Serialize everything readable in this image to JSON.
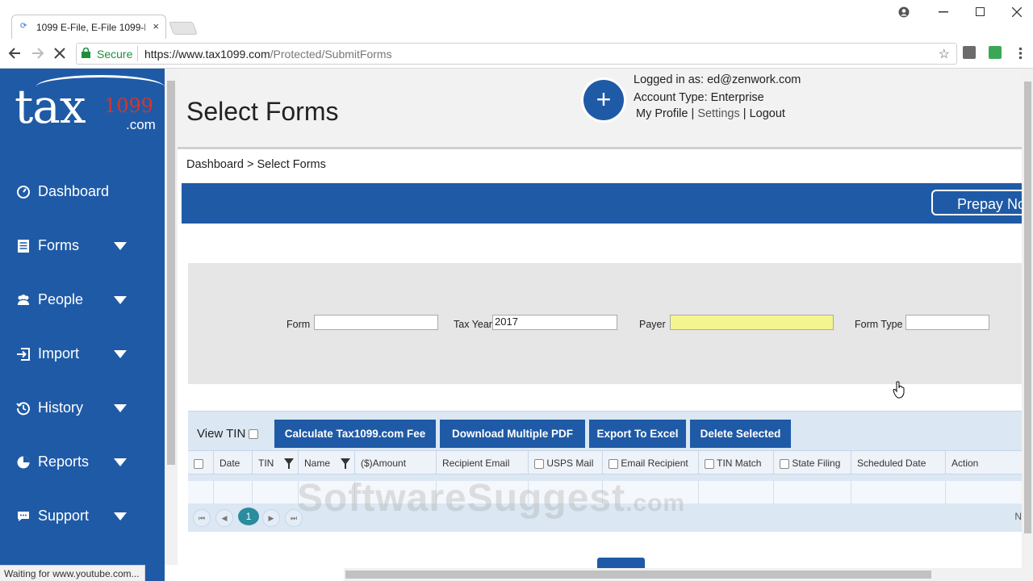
{
  "browser": {
    "tab_title": "1099 E-File, E-File 1099-M",
    "tab_close": "×",
    "secure_label": "Secure",
    "url_base": "https://www.tax1099.com",
    "url_path": "/Protected/SubmitForms"
  },
  "logo": {
    "text": "tax",
    "number": "1099",
    "suffix": ".com"
  },
  "sidebar": {
    "items": [
      {
        "label": "Dashboard",
        "icon": "dashboard-icon"
      },
      {
        "label": "Forms",
        "icon": "list-icon"
      },
      {
        "label": "People",
        "icon": "people-icon"
      },
      {
        "label": "Import",
        "icon": "import-icon"
      },
      {
        "label": "History",
        "icon": "history-icon"
      },
      {
        "label": "Reports",
        "icon": "pie-chart-icon"
      },
      {
        "label": "Support",
        "icon": "chat-icon"
      }
    ]
  },
  "header": {
    "title": "Select Forms",
    "plus": "+",
    "logged_in": "Logged in as: ed@zenwork.com",
    "account_type": "Account Type: Enterprise",
    "my_profile": "My Profile",
    "settings": "Settings",
    "logout": "Logout",
    "sep": "|"
  },
  "breadcrumb": "Dashboard > Select Forms",
  "prepay_label": "Prepay No",
  "filters": {
    "form_label": "Form",
    "form_value": "",
    "tax_year_label": "Tax Year",
    "tax_year_value": "2017",
    "payer_label": "Payer",
    "payer_value": "",
    "form_type_label": "Form Type",
    "form_type_value": ""
  },
  "grid": {
    "view_tin": "View TIN",
    "buttons": {
      "calculate": "Calculate Tax1099.com Fee",
      "download": "Download Multiple PDF",
      "export": "Export To Excel",
      "delete": "Delete Selected"
    },
    "columns": [
      "Date",
      "TIN",
      "Name",
      "($)Amount",
      "Recipient Email",
      "USPS Mail",
      "Email Recipient",
      "TIN Match",
      "State Filing",
      "Scheduled Date",
      "Action"
    ],
    "pager": {
      "first": "⏮",
      "prev": "◀",
      "current": "1",
      "next": "▶",
      "last": "⏭",
      "right_text": "N"
    }
  },
  "watermark": {
    "main": "SoftwareSuggest",
    "suffix": ".com"
  },
  "status": "Waiting for www.youtube.com...",
  "colors": {
    "brand_blue": "#1f5aa6",
    "payer_highlight": "#f5f590",
    "logo_red": "#d9342b"
  }
}
